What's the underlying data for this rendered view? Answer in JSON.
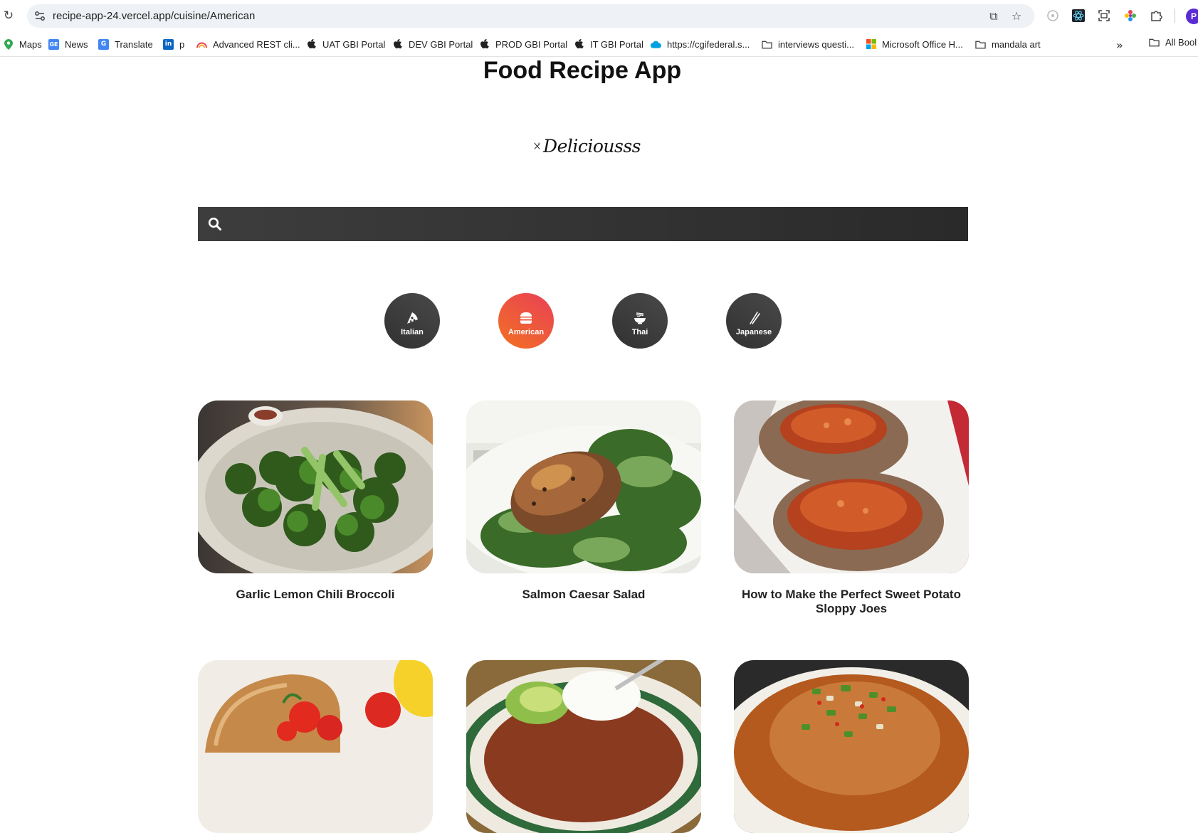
{
  "browser": {
    "url": "recipe-app-24.vercel.app/cuisine/American",
    "profile_initial": "P",
    "bookmarks": [
      {
        "label": "Maps",
        "icon": "maps-pin-icon"
      },
      {
        "label": "News",
        "icon": "google-news-icon"
      },
      {
        "label": "Translate",
        "icon": "google-translate-icon"
      },
      {
        "label": "p",
        "icon": "linkedin-icon"
      },
      {
        "label": "Advanced REST cli...",
        "icon": "rest-client-icon"
      },
      {
        "label": "UAT GBI Portal",
        "icon": "apple-icon"
      },
      {
        "label": "DEV GBI Portal",
        "icon": "apple-icon"
      },
      {
        "label": "PROD GBI Portal",
        "icon": "apple-icon"
      },
      {
        "label": "IT GBI Portal",
        "icon": "apple-icon"
      },
      {
        "label": "https://cgifederal.s...",
        "icon": "salesforce-cloud-icon"
      },
      {
        "label": "interviews questi...",
        "icon": "folder-icon"
      },
      {
        "label": "Microsoft Office H...",
        "icon": "microsoft-icon"
      },
      {
        "label": "mandala art",
        "icon": "folder-icon"
      }
    ],
    "all_bookmarks_label": "All Bool"
  },
  "page": {
    "title": "Food Recipe App",
    "logo_text": "Deliciousss",
    "search": {
      "value": "",
      "placeholder": ""
    }
  },
  "categories": [
    {
      "label": "Italian",
      "icon": "pizza-icon",
      "active": false
    },
    {
      "label": "American",
      "icon": "hamburger-icon",
      "active": true
    },
    {
      "label": "Thai",
      "icon": "noodle-bowl-icon",
      "active": false
    },
    {
      "label": "Japanese",
      "icon": "chopsticks-icon",
      "active": false
    }
  ],
  "recipes": [
    {
      "title": "Garlic Lemon Chili Broccoli",
      "image": "broccoli-dish"
    },
    {
      "title": "Salmon Caesar Salad",
      "image": "salmon-salad-dish"
    },
    {
      "title": "How to Make the Perfect Sweet Potato Sloppy Joes",
      "image": "sweet-potato-dish"
    },
    {
      "title": "",
      "image": "burger-dish"
    },
    {
      "title": "",
      "image": "chili-sour-cream-dish"
    },
    {
      "title": "",
      "image": "asian-fish-dish"
    }
  ],
  "colors": {
    "active_category": "#f27121",
    "category_dark": "#313131",
    "search_bar": "#333333"
  }
}
